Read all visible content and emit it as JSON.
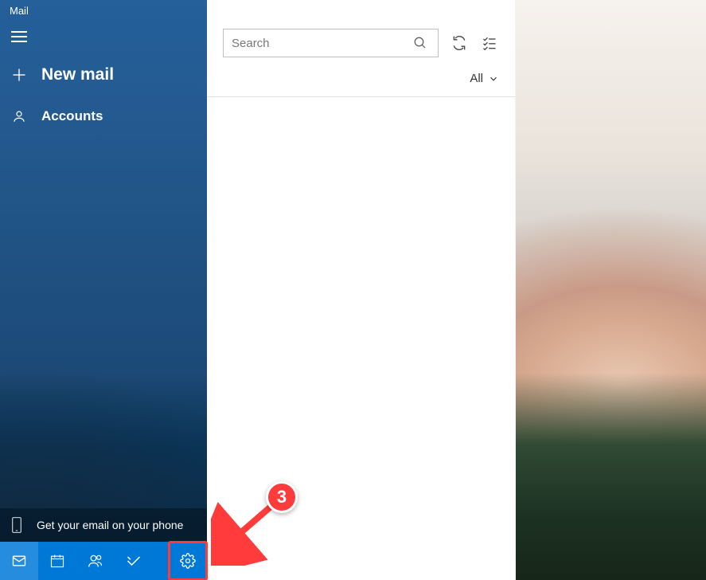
{
  "app": {
    "title": "Mail"
  },
  "sidebar": {
    "new_mail_label": "New mail",
    "accounts_label": "Accounts",
    "promo_label": "Get your email on your phone"
  },
  "search": {
    "placeholder": "Search"
  },
  "filter": {
    "label": "All"
  },
  "annotation": {
    "step_number": "3"
  },
  "colors": {
    "accent": "#0078d7",
    "highlight": "#ff3b3b"
  }
}
